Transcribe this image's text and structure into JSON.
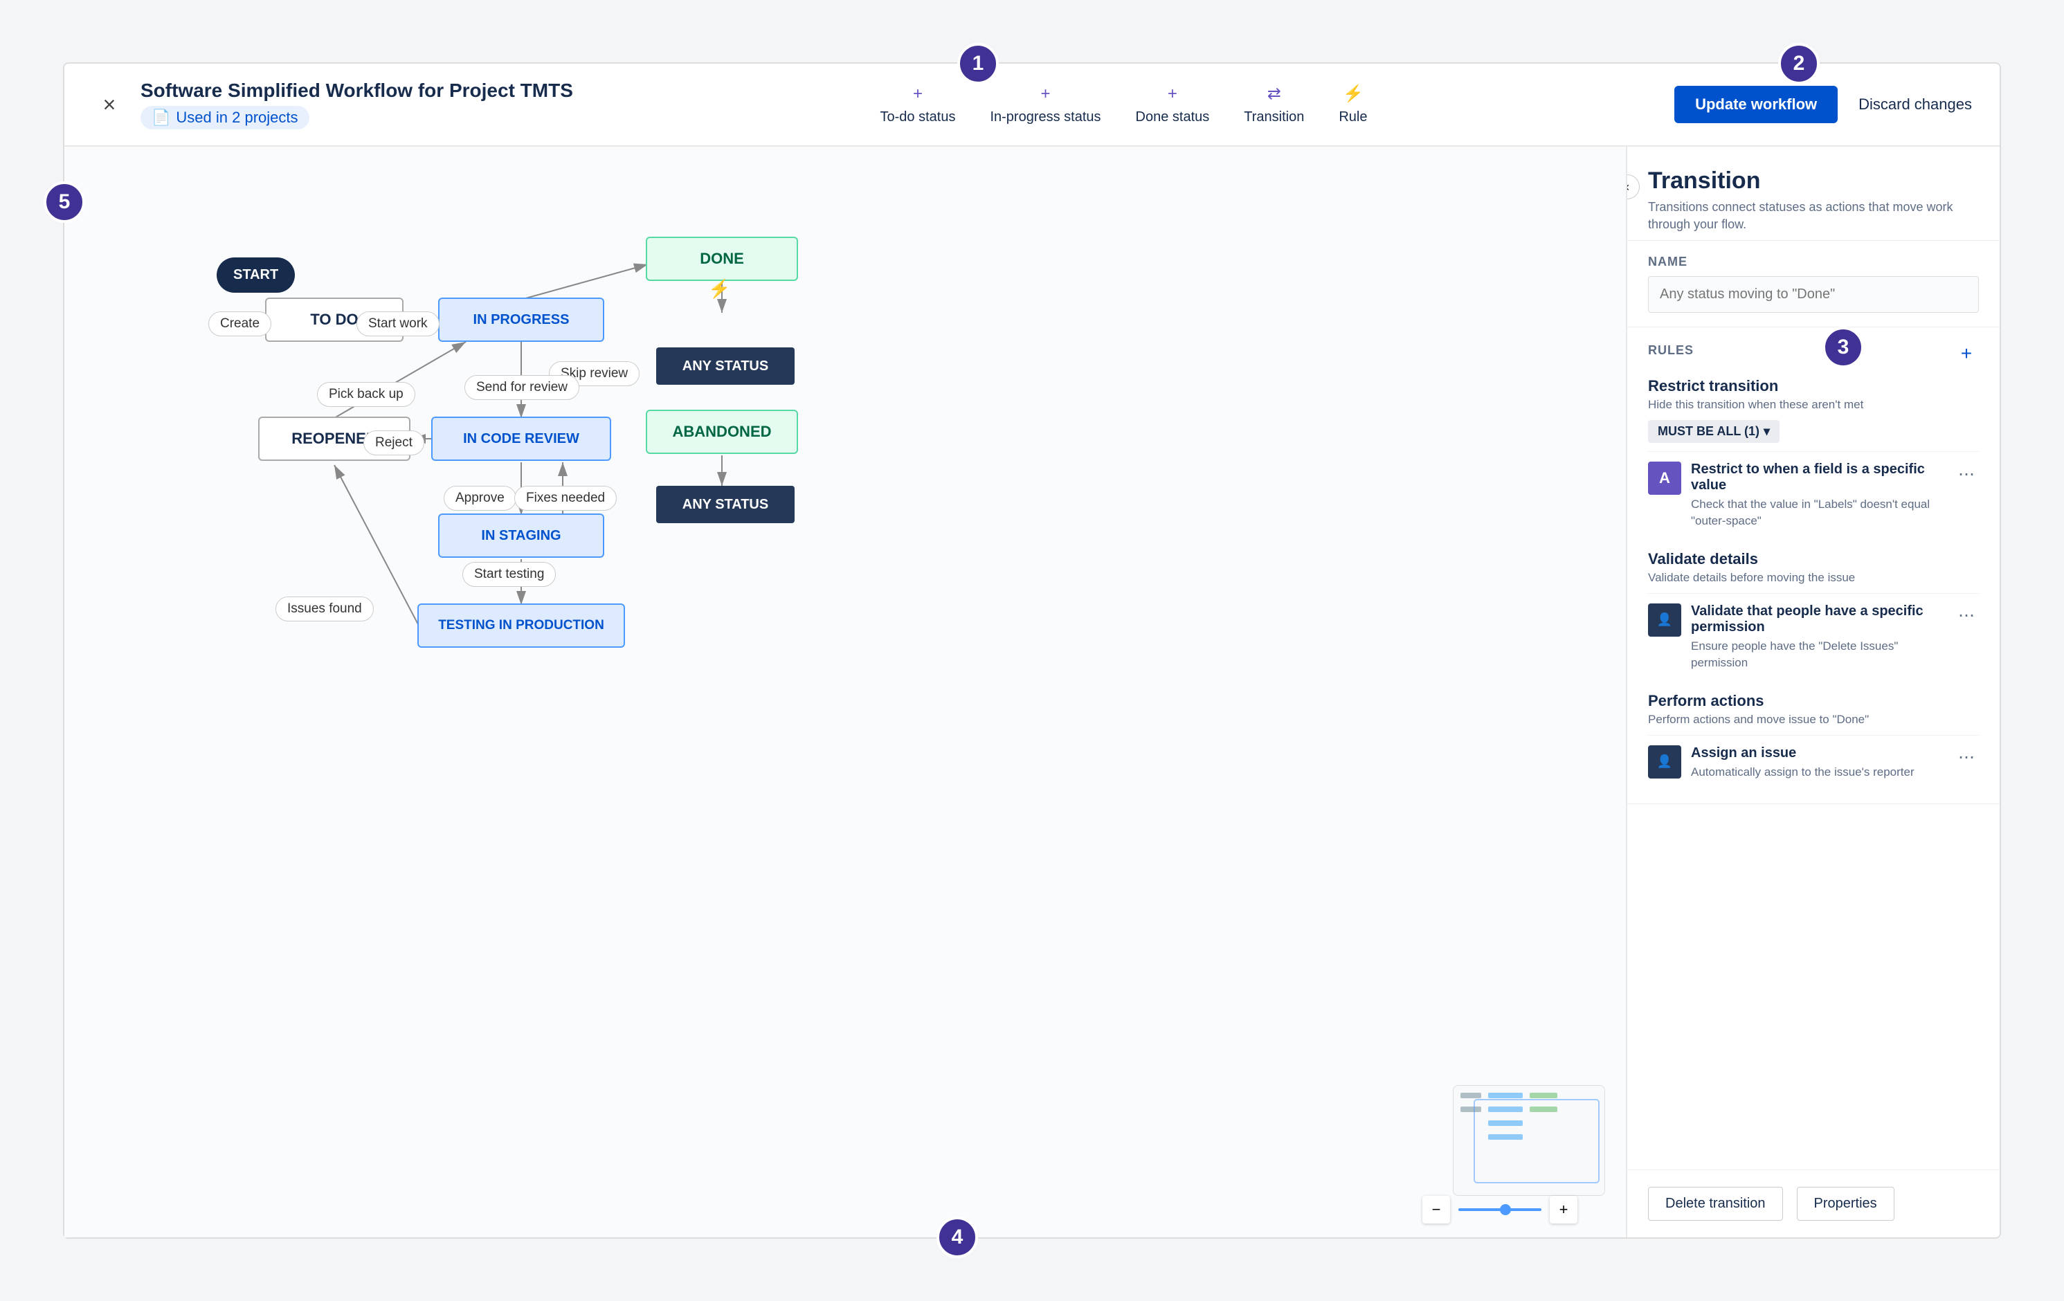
{
  "toolbar": {
    "close_label": "×",
    "title": "Software Simplified Workflow for Project TMTS",
    "used_in": "Used in 2 projects",
    "actions": [
      {
        "id": "todo-status",
        "icon": "+",
        "label": "To-do status"
      },
      {
        "id": "inprogress-status",
        "icon": "+",
        "label": "In-progress status"
      },
      {
        "id": "done-status",
        "icon": "+",
        "label": "Done status"
      },
      {
        "id": "transition",
        "icon": "⇄",
        "label": "Transition"
      },
      {
        "id": "rule",
        "icon": "⚡",
        "label": "Rule"
      }
    ],
    "update_label": "Update workflow",
    "discard_label": "Discard changes"
  },
  "numbered_hints": [
    {
      "id": 1,
      "label": "1"
    },
    {
      "id": 2,
      "label": "2"
    },
    {
      "id": 3,
      "label": "3"
    },
    {
      "id": 4,
      "label": "4"
    },
    {
      "id": 5,
      "label": "5"
    }
  ],
  "nodes": {
    "start": "START",
    "todo": "TO DO",
    "inprogress": "IN PROGRESS",
    "done": "DONE",
    "incodereview": "IN CODE REVIEW",
    "reopened": "REOPENED",
    "abandoned": "ABANDONED",
    "instaging": "IN STAGING",
    "testinginprod": "TESTING IN PRODUCTION",
    "anystatus1": "ANY STATUS",
    "anystatus2": "ANY STATUS"
  },
  "transitions": {
    "create": "Create",
    "startwork": "Start work",
    "skipreview": "Skip review",
    "sendreview": "Send for review",
    "pickbackup": "Pick back up",
    "reject": "Reject",
    "approve": "Approve",
    "fixesneeded": "Fixes needed",
    "starttesting": "Start testing",
    "issuesfound": "Issues found"
  },
  "right_panel": {
    "title": "Transition",
    "subtitle": "Transitions connect statuses as actions that move work through your flow.",
    "name_label": "NAME",
    "name_placeholder": "Any status moving to \"Done\"",
    "rules_label": "RULES",
    "restrict_title": "Restrict transition",
    "restrict_sub": "Hide this transition when these aren't met",
    "must_be_all": "MUST BE ALL (1)",
    "restrict_rule": {
      "icon": "A",
      "name": "Restrict to when a field is a specific value",
      "desc": "Check that the value in \"Labels\" doesn't equal \"outer-space\""
    },
    "validate_title": "Validate details",
    "validate_sub": "Validate details before moving the issue",
    "validate_rule": {
      "icon": "👤",
      "name": "Validate that people have a specific permission",
      "desc": "Ensure people have the \"Delete Issues\" permission"
    },
    "perform_title": "Perform actions",
    "perform_sub": "Perform actions and move issue to \"Done\"",
    "perform_rule": {
      "icon": "👤",
      "name": "Assign an issue",
      "desc": "Automatically assign to the issue's reporter"
    },
    "delete_btn": "Delete transition",
    "properties_btn": "Properties"
  }
}
